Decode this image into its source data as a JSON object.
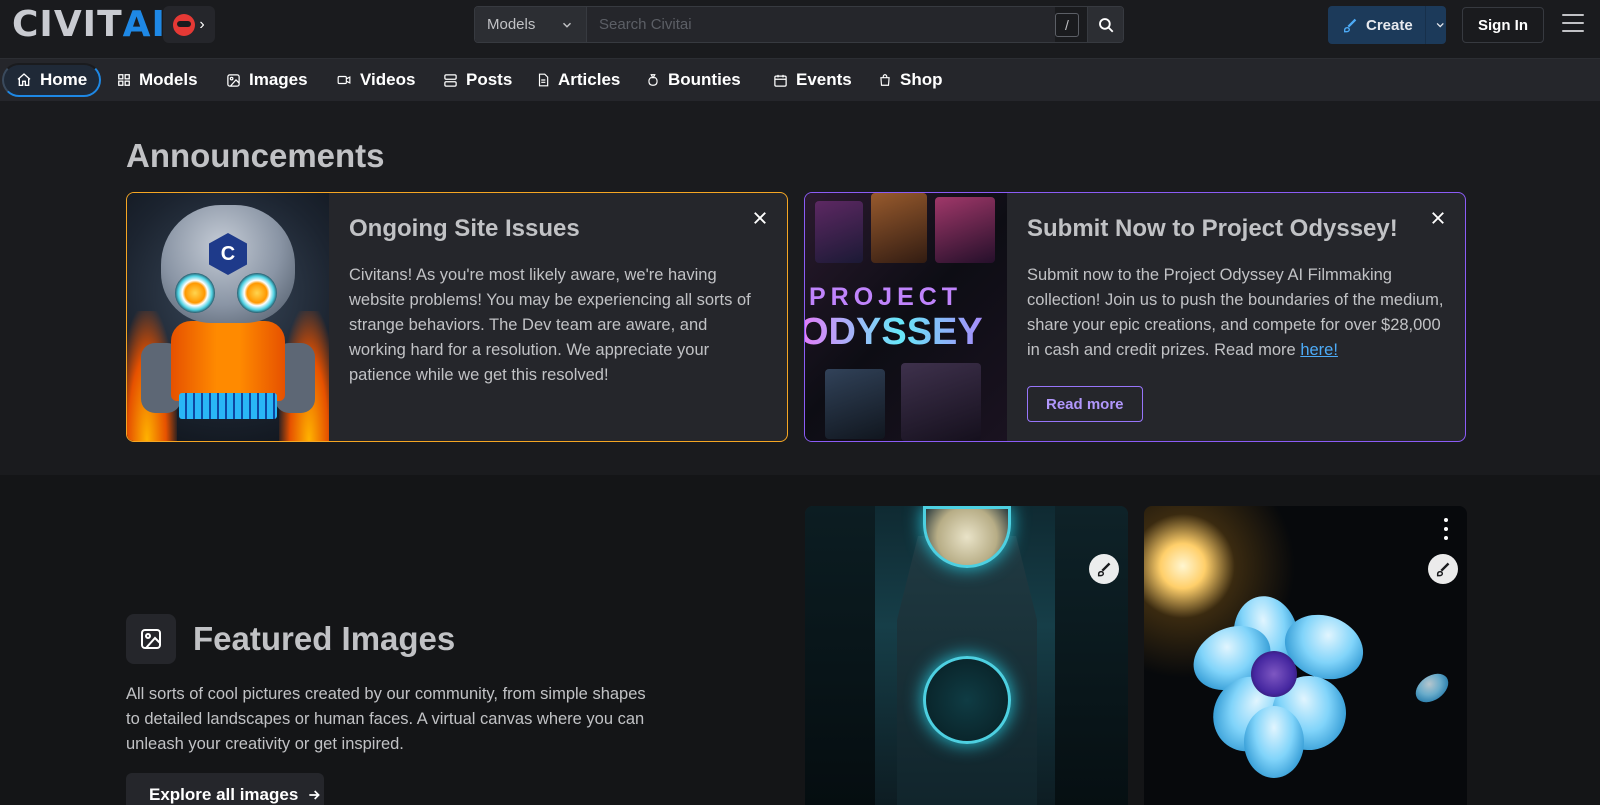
{
  "header": {
    "logo_main": "CIVIT",
    "logo_accent": "AI",
    "search": {
      "category": "Models",
      "placeholder": "Search Civitai",
      "shortcut": "/"
    },
    "create_label": "Create",
    "signin_label": "Sign In"
  },
  "nav": {
    "items": [
      {
        "label": "Home",
        "icon": "home-icon"
      },
      {
        "label": "Models",
        "icon": "grid-icon"
      },
      {
        "label": "Images",
        "icon": "image-icon"
      },
      {
        "label": "Videos",
        "icon": "video-icon"
      },
      {
        "label": "Posts",
        "icon": "layers-icon"
      },
      {
        "label": "Articles",
        "icon": "file-text-icon"
      },
      {
        "label": "Bounties",
        "icon": "money-bag-icon"
      },
      {
        "label": "Events",
        "icon": "calendar-icon"
      },
      {
        "label": "Shop",
        "icon": "shopping-bag-icon"
      }
    ],
    "active": "Home"
  },
  "announcements": {
    "title": "Announcements",
    "cards": [
      {
        "title": "Ongoing Site Issues",
        "body": "Civitans! As you're most likely aware, we're having website problems! You may be experiencing all sorts of strange behaviors. The Dev team are aware, and working hard for a resolution. We appreciate your patience while we get this resolved!",
        "badge_letter": "C",
        "accent": "#f5a623"
      },
      {
        "title": "Submit Now to Project Odyssey!",
        "body_before_link": "Submit now to the Project Odyssey AI Filmmaking collection! Join us to push the boundaries of the medium, share your epic creations, and compete for over $28,000 in cash and credit prizes. Read more ",
        "link_text": "here!",
        "button": "Read more",
        "image_text_top": "PROJECT",
        "image_text_bottom": "ODYSSEY",
        "accent": "#8b5cf6"
      }
    ]
  },
  "featured": {
    "title": "Featured Images",
    "description": "All sorts of cool pictures created by our community, from simple shapes to detailed landscapes or human faces. A virtual canvas where you can unleash your creativity or get inspired.",
    "explore_label": "Explore all images"
  },
  "colors": {
    "background": "#1a1b1e",
    "brand_blue": "#1e88e5",
    "announcement_orange": "#f5a623",
    "announcement_purple": "#8b5cf6"
  }
}
